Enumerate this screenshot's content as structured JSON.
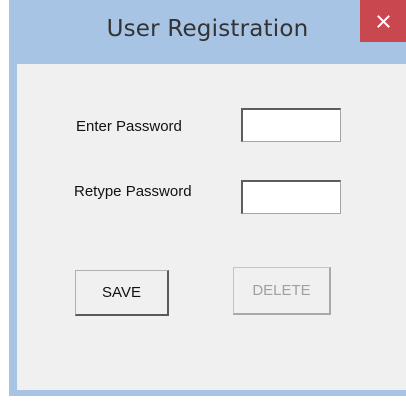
{
  "window": {
    "title": "User Registration",
    "close_icon": "close-icon",
    "colors": {
      "frame": "#a8c4e4",
      "close_button": "#c9474f",
      "client_background": "#f0f0f0"
    }
  },
  "form": {
    "password_label": "Enter Password",
    "password_value": "",
    "retype_label": "Retype Password",
    "retype_value": ""
  },
  "buttons": {
    "save_label": "SAVE",
    "delete_label": "DELETE",
    "delete_enabled": false
  }
}
